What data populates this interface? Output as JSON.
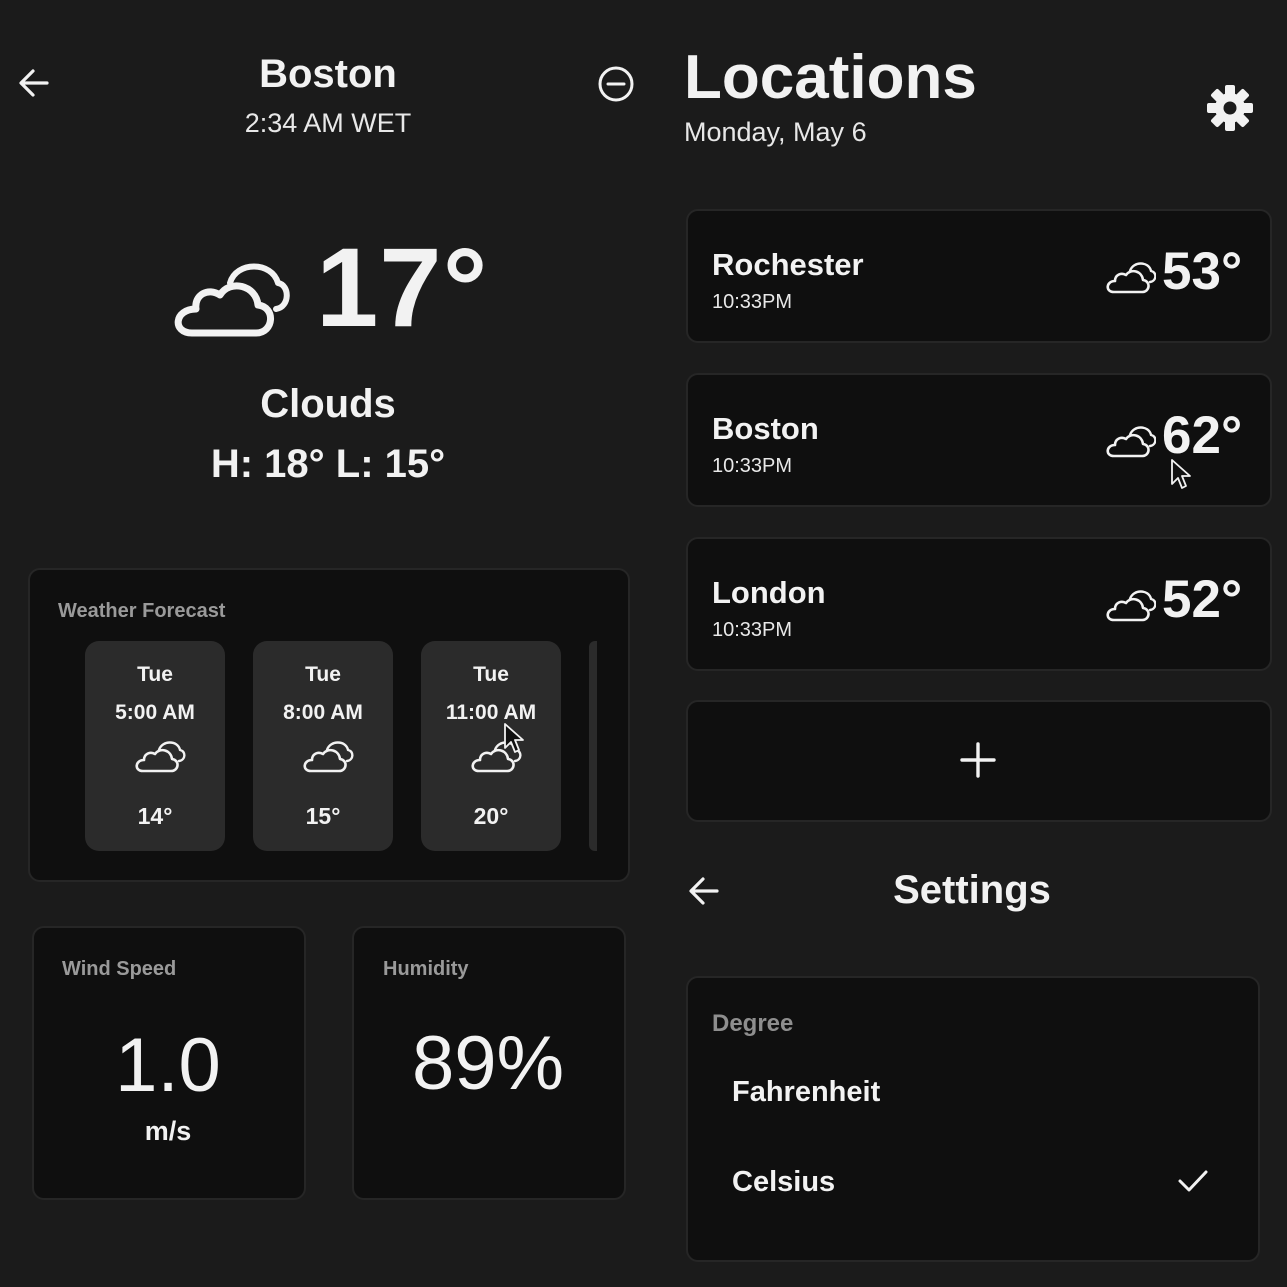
{
  "detail": {
    "city": "Boston",
    "local_time": "2:34 AM WET",
    "temperature": "17°",
    "condition": "Clouds",
    "high_low": "H: 18° L: 15°",
    "condition_icon": "clouds-icon"
  },
  "forecast": {
    "title": "Weather Forecast",
    "items": [
      {
        "day": "Tue",
        "time": "5:00 AM",
        "icon": "clouds-icon",
        "temp": "14°"
      },
      {
        "day": "Tue",
        "time": "8:00 AM",
        "icon": "clouds-icon",
        "temp": "15°"
      },
      {
        "day": "Tue",
        "time": "11:00 AM",
        "icon": "clouds-icon",
        "temp": "20°"
      }
    ]
  },
  "wind": {
    "title": "Wind Speed",
    "value": "1.0",
    "unit": "m/s"
  },
  "humidity": {
    "title": "Humidity",
    "value": "89%"
  },
  "locations": {
    "title": "Locations",
    "date": "Monday, May 6",
    "items": [
      {
        "name": "Rochester",
        "time": "10:33PM",
        "temp": "53°",
        "icon": "clouds-icon"
      },
      {
        "name": "Boston",
        "time": "10:33PM",
        "temp": "62°",
        "icon": "clouds-icon"
      },
      {
        "name": "London",
        "time": "10:33PM",
        "temp": "52°",
        "icon": "clouds-icon"
      }
    ],
    "add_icon": "plus-icon"
  },
  "settings": {
    "title": "Settings",
    "degree_label": "Degree",
    "options": [
      {
        "label": "Fahrenheit",
        "selected": false
      },
      {
        "label": "Celsius",
        "selected": true
      }
    ]
  },
  "colors": {
    "background": "#1b1b1b",
    "card": "#0f0f0f",
    "tile": "#2b2b2b",
    "text": "#f2f2f2",
    "muted": "#9a9a9a"
  }
}
